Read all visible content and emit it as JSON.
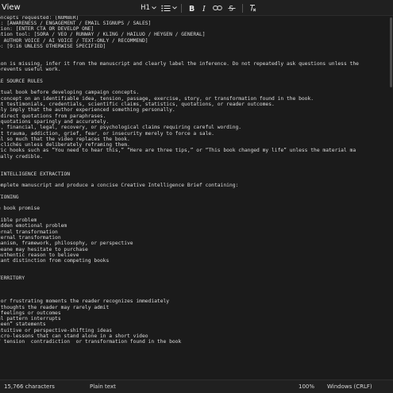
{
  "menu": {
    "view_label": "View"
  },
  "toolbar": {
    "heading": "H1",
    "list_bullet": "•",
    "items": [
      "heading-dropdown",
      "list",
      "bold",
      "italic",
      "link",
      "strikethrough",
      "clear-format"
    ]
  },
  "editor": {
    "lines": [
      "oncepts requested: [NUMBER]",
      "l: [AWARENESS / ENGAGEMENT / EMAIL SIGNUPS / SALES]",
      "tion: [ENTER CTA OR DEVELOP ONE]",
      "ation tool: [SORA / VEO / RUNWAY / KLING / HAILUO / HEYGEN / GENERAL]",
      ": AUTHOR VOICE / AI VOICE / TEXT-ONLY / RECOMMEND]",
      "o: [9:16 UNLESS OTHERWISE SPECIFIED]",
      "",
      "",
      "ion is missing, infer it from the manuscript and clearly label the inference. Do not repeatedly ask questions unless the",
      "prevents useful work.",
      "",
      "LE SOURCE RULES",
      "",
      "ctual book before developing campaign concepts.",
      " concept on an identifiable idea, tension, passage, exercise, story, or transformation found in the book.",
      "nt testimonials, credentials, scientific claims, statistics, quotations, or reader outcomes.",
      "ely imply that the author experienced something personally.",
      " direct quotations from paraphrases.",
      " quotations sparingly and accurately.",
      "l, financial, legal, recovery, or psychological claims requiring careful wording.",
      "it trauma, addiction, grief, fear, or insecurity merely to force a sale.",
      "al so much that the video replaces the book.",
      " clichés unless deliberately reframing them.",
      "ric hooks such as “You need to hear this,” “Here are three tips,” or “This book changed my life” unless the material ma",
      "ually credible.",
      "",
      "",
      " INTELLIGENCE EXTRACTION",
      "",
      "omplete manuscript and produce a concise Creative Intelligence Brief containing:",
      "",
      "TIONING",
      "",
      "e book promise",
      "",
      "sible problem",
      "idden emotional problem",
      "ernal transformation",
      "ternal transformation",
      "hanism, framework, philosophy, or perspective",
      "eeane may hesitate to purchase",
      "authentic reason to believe",
      "tant distinction from competing books",
      "",
      "",
      "TERRITORY",
      "",
      "",
      "",
      " or frustrating moments the reader recognizes immediately",
      " thoughts the reader may rarely admit",
      " feelings or outcomes",
      "ul pattern interrupts",
      "seen” statements",
      "ntuitive or perspective-shifting ideas",
      "icro-lessons that can stand alone in a short video",
      "f tension  contradiction  or transformation found in the book"
    ]
  },
  "status": {
    "characters": "15,766 characters",
    "format": "Plain text",
    "zoom": "100%",
    "line_ending": "Windows (CRLF)"
  }
}
